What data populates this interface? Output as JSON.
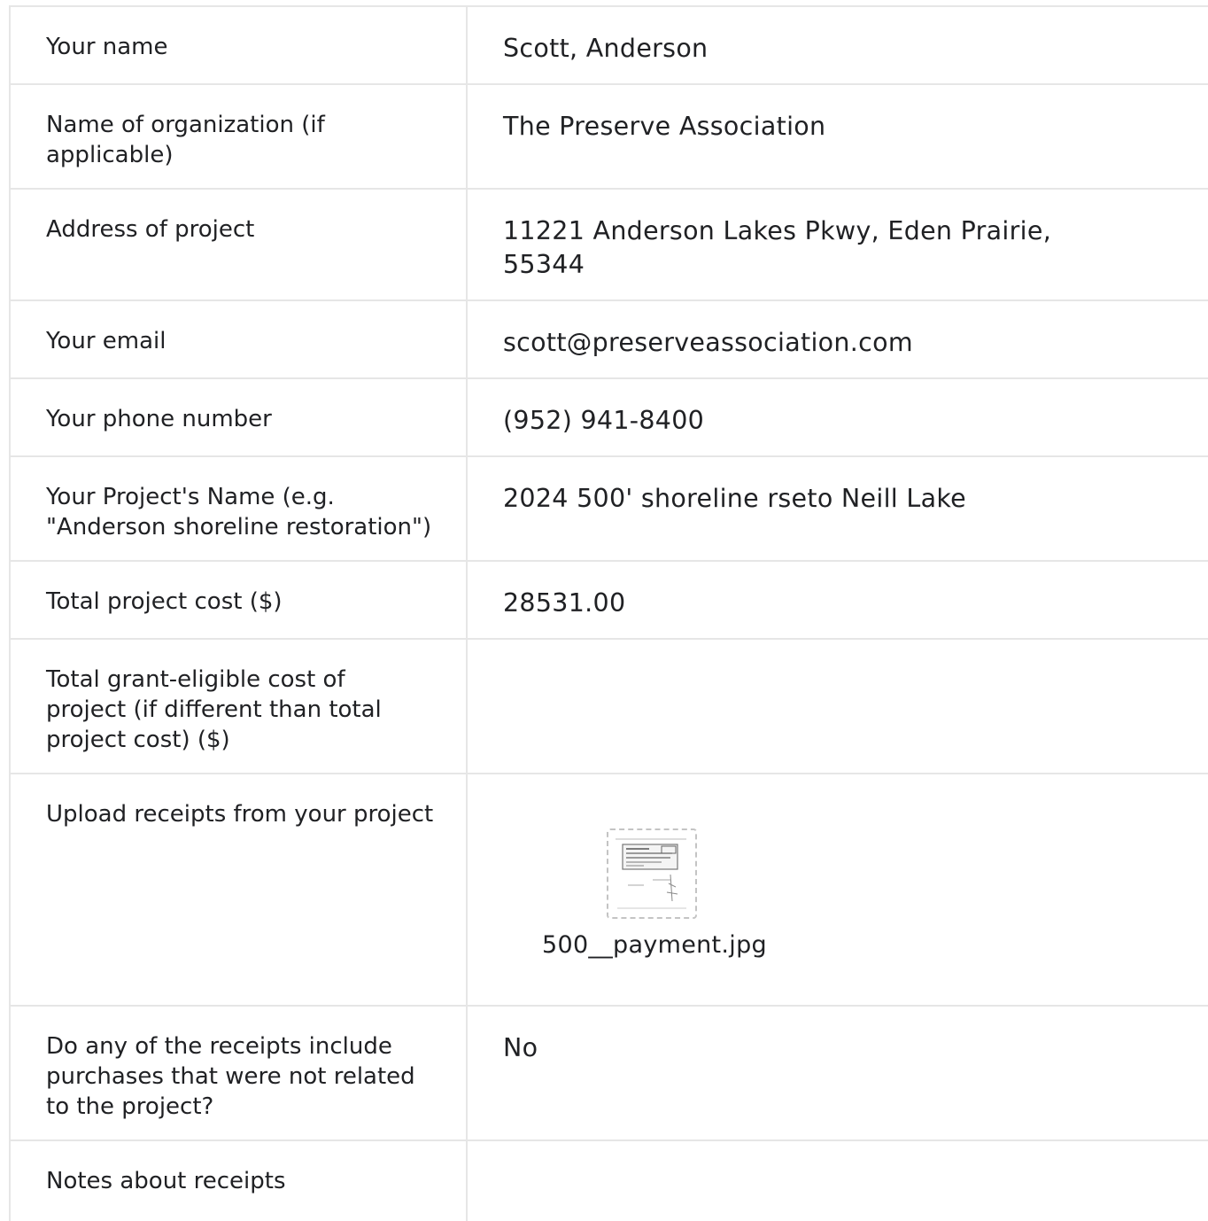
{
  "rows": [
    {
      "label": "Your name",
      "value": "Scott, Anderson"
    },
    {
      "label": "Name of organization (if\napplicable)",
      "value": "The Preserve Association"
    },
    {
      "label": "Address of project",
      "value": "11221 Anderson Lakes Pkwy, Eden Prairie,\n55344"
    },
    {
      "label": "Your email",
      "value": "scott@preserveassociation.com"
    },
    {
      "label": "Your phone number",
      "value": "(952) 941-8400"
    },
    {
      "label": "Your Project's Name (e.g.\n\"Anderson shoreline restoration\")",
      "value": "2024 500' shoreline rseto Neill Lake"
    },
    {
      "label": "Total project cost ($)",
      "value": "28531.00"
    },
    {
      "label": "Total grant-eligible cost of\nproject (if different than total\nproject cost) ($)",
      "value": ""
    },
    {
      "label": "Upload receipts from your project",
      "file_name": "500__payment.jpg"
    },
    {
      "label": "Do any of the receipts include\npurchases that were not related\nto the project?",
      "value": "No"
    },
    {
      "label": "Notes about receipts",
      "value": ""
    }
  ],
  "icons": {
    "attachment": "receipt-thumbnail-icon"
  }
}
